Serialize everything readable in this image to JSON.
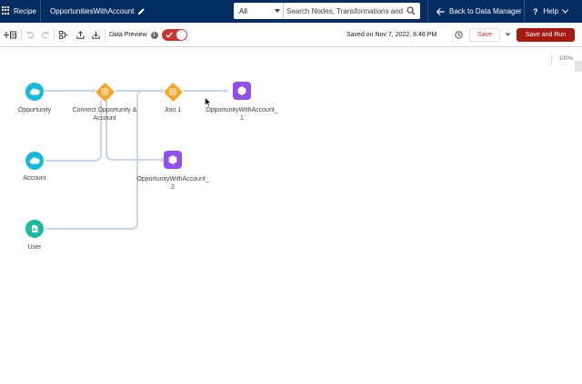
{
  "header": {
    "app_label": "Recipe",
    "recipe_name": "OpportunitiesWithAccount",
    "scope_value": "All",
    "search_placeholder": "Search Nodes, Transformations and",
    "back_label": "Back to Data Manager",
    "help_label": "Help",
    "colors": {
      "bar": "#032d60",
      "text": "#ffffff"
    }
  },
  "toolbar": {
    "data_preview_label": "Data Preview",
    "data_preview_enabled": true,
    "saved_status": "Saved on Nov 7, 2022, 8:46 PM",
    "save_label": "Save",
    "save_run_label": "Save and Run",
    "colors": {
      "save_run_bg": "#a61a14",
      "toggle_on": "#c23934"
    }
  },
  "canvas": {
    "zoom_label": "100%",
    "nodes": {
      "opportunity": {
        "label": "Opportunity",
        "icon": "salesforce-cloud-icon"
      },
      "account": {
        "label": "Account",
        "icon": "salesforce-cloud-icon"
      },
      "user": {
        "label": "User",
        "icon": "dataset-icon"
      },
      "join_connect": {
        "label": "Connect Opportunity & Account",
        "icon": "join-icon"
      },
      "join_1": {
        "label": "Join 1",
        "icon": "join-icon"
      },
      "output_1": {
        "label": "OpportunityWithAccount_1",
        "icon": "output-hexagon-icon"
      },
      "output_2": {
        "label": "OpportunityWithAccount_2",
        "icon": "output-hexagon-icon"
      }
    },
    "colors": {
      "source": "#1ab9d9",
      "user_source": "#20b7a0",
      "join": "#f4a52a",
      "output": "#9050e9",
      "link": "#c9d6e8"
    }
  }
}
